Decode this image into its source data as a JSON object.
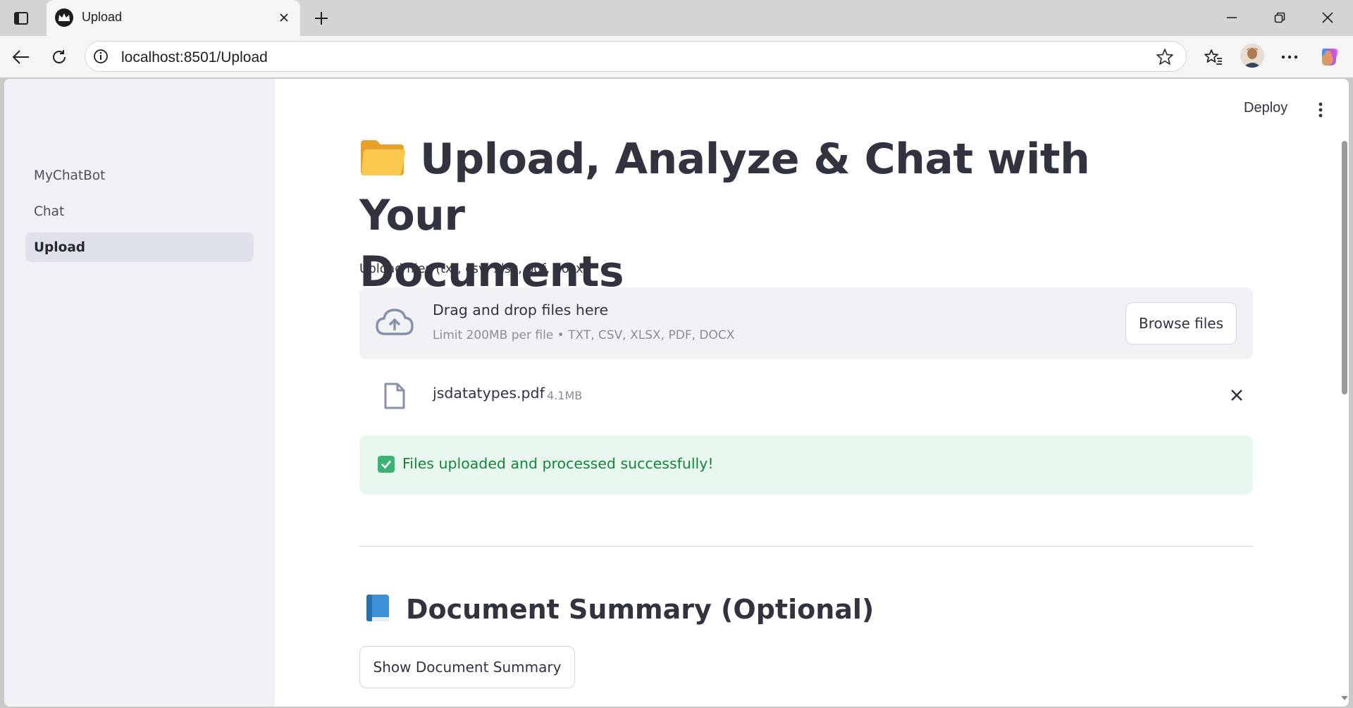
{
  "browser": {
    "tab_title": "Upload",
    "url": "localhost:8501/Upload"
  },
  "sidebar": {
    "items": [
      {
        "label": "MyChatBot",
        "active": false
      },
      {
        "label": "Chat",
        "active": false
      },
      {
        "label": "Upload",
        "active": true
      }
    ]
  },
  "header": {
    "deploy_label": "Deploy"
  },
  "main": {
    "title_emoji": "folder-icon",
    "title_line1": "Upload, Analyze & Chat with Your",
    "title_line2": "Documents",
    "upload_label": "Upload files (txt, csv, xlsx, pdf, docx)",
    "dropzone": {
      "title": "Drag and drop files here",
      "limit": "Limit 200MB per file • TXT, CSV, XLSX, PDF, DOCX",
      "browse_label": "Browse files"
    },
    "file": {
      "name": "jsdatatypes.pdf",
      "size": "4.1MB"
    },
    "success_message": "Files uploaded and processed successfully!",
    "summary_heading": "Document Summary (Optional)",
    "summary_button": "Show Document Summary"
  },
  "colors": {
    "sidebar_bg": "#f0f2f6",
    "success_bg": "#e8f8ee",
    "success_text": "#16823c",
    "text": "#31333f"
  }
}
